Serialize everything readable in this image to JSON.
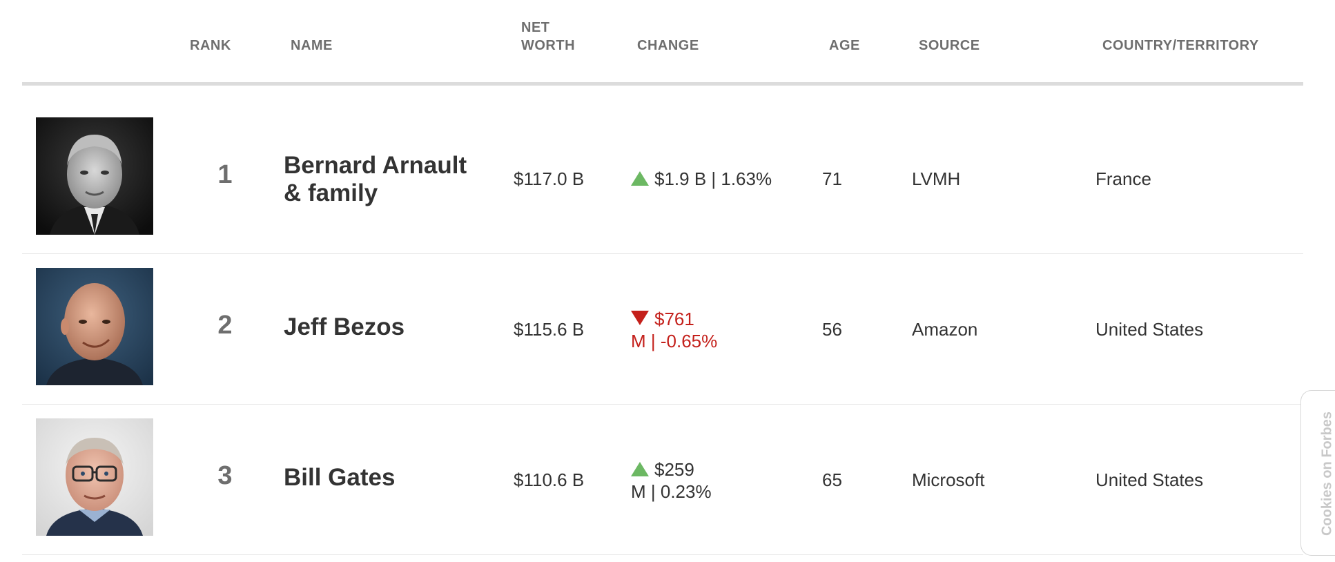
{
  "columns": {
    "rank": "RANK",
    "name": "NAME",
    "net_worth_line1": "NET",
    "net_worth_line2": "WORTH",
    "change": "CHANGE",
    "age": "AGE",
    "source": "SOURCE",
    "country": "COUNTRY/TERRITORY"
  },
  "rows": [
    {
      "rank": "1",
      "name_line1": "Bernard Arnault",
      "name_line2": "& family",
      "net_worth": "$117.0 B",
      "change_direction": "up",
      "change_line1": "$1.9 B | 1.63%",
      "change_line2": "",
      "age": "71",
      "source": "LVMH",
      "country": "France"
    },
    {
      "rank": "2",
      "name_line1": "Jeff Bezos",
      "name_line2": "",
      "net_worth": "$115.6 B",
      "change_direction": "down",
      "change_line1": "$761",
      "change_line2": "M | -0.65%",
      "age": "56",
      "source": "Amazon",
      "country": "United States"
    },
    {
      "rank": "3",
      "name_line1": "Bill Gates",
      "name_line2": "",
      "net_worth": "$110.6 B",
      "change_direction": "up",
      "change_line1": "$259",
      "change_line2": "M | 0.23%",
      "age": "65",
      "source": "Microsoft",
      "country": "United States"
    }
  ],
  "colors": {
    "up": "#6cb863",
    "down": "#c4201b",
    "header_text": "#6e6e6e",
    "text": "#333333"
  },
  "cookies_tab": {
    "label": "Cookies on Forbes"
  }
}
